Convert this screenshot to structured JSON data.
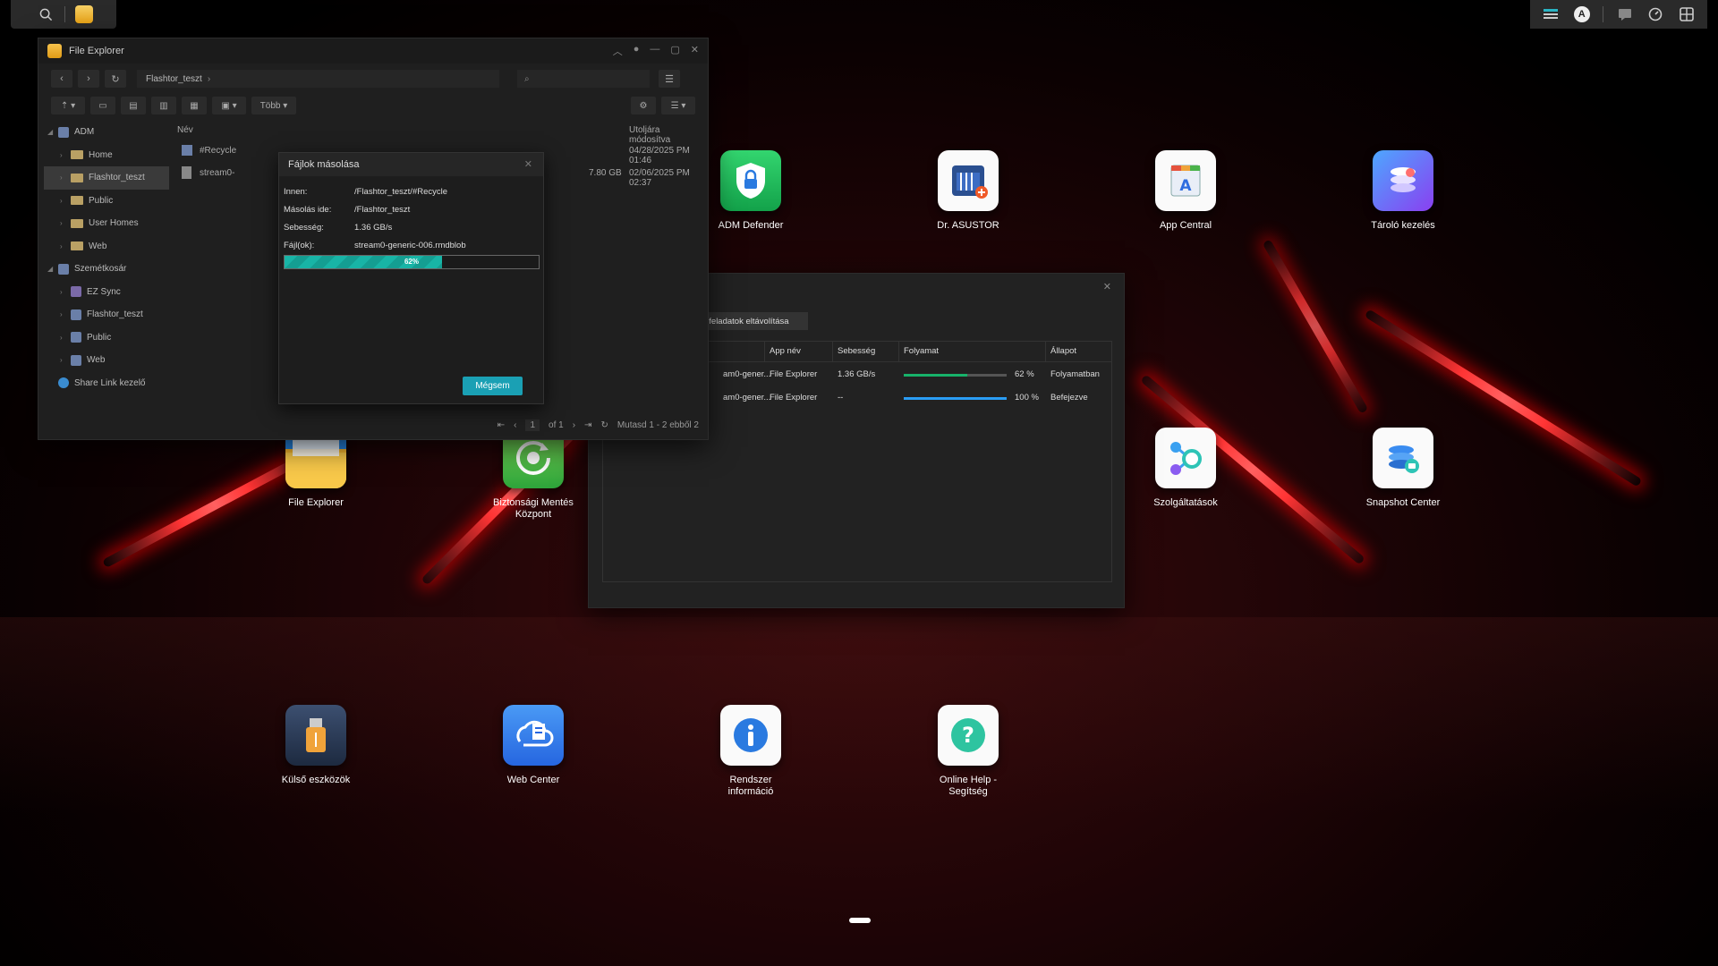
{
  "colors": {
    "accent": "#1aa0b4",
    "progress_green": "#17b26a",
    "progress_blue": "#2a9df4"
  },
  "taskbar": {
    "left_icons": [
      "search-icon",
      "file-explorer-icon"
    ],
    "right_icons": [
      "task-monitor-icon",
      "user-avatar-icon",
      "message-icon",
      "dashboard-icon",
      "app-grid-icon"
    ],
    "user_initial": "A"
  },
  "desktop_apps": [
    {
      "id": "adm-defender",
      "label": "ADM Defender",
      "icon": "shield-lock-icon",
      "color": "#20c15a"
    },
    {
      "id": "dr-asustor",
      "label": "Dr. ASUSTOR",
      "icon": "server-plus-icon",
      "color": "#ffffff"
    },
    {
      "id": "app-central",
      "label": "App Central",
      "icon": "store-icon",
      "color": "#ffffff"
    },
    {
      "id": "storage",
      "label": "Tároló kezelés",
      "icon": "disks-icon",
      "color": "#6a6cf0"
    },
    {
      "id": "file-explorer",
      "label": "File Explorer",
      "icon": "folder-icon",
      "color": "#f5b72a"
    },
    {
      "id": "backup",
      "label_lines": [
        "Biztonsági Mentés",
        "Központ"
      ],
      "icon": "backup-icon",
      "color": "#4fc13a"
    },
    {
      "id": "services",
      "label": "Szolgáltatások",
      "icon": "services-icon",
      "color": "#ffffff"
    },
    {
      "id": "snapshot",
      "label": "Snapshot Center",
      "icon": "snapshot-icon",
      "color": "#ffffff"
    },
    {
      "id": "external",
      "label": "Külső eszközök",
      "icon": "usb-icon",
      "color": "#2c3e5c"
    },
    {
      "id": "web-center",
      "label": "Web Center",
      "icon": "web-center-icon",
      "color": "#2f7bf0"
    },
    {
      "id": "sysinfo",
      "label_lines": [
        "Rendszer",
        "információ"
      ],
      "icon": "info-icon",
      "color": "#ffffff"
    },
    {
      "id": "help",
      "label_lines": [
        "Online Help -",
        "Segítség"
      ],
      "icon": "help-icon",
      "color": "#ffffff"
    }
  ],
  "file_explorer": {
    "title": "File Explorer",
    "path": "Flashtor_teszt",
    "search_placeholder": "",
    "more_label": "Több",
    "tree": [
      {
        "label": "ADM",
        "level": 0,
        "type": "vol"
      },
      {
        "label": "Home",
        "level": 1,
        "type": "folder"
      },
      {
        "label": "Flashtor_teszt",
        "level": 1,
        "type": "folder",
        "selected": true
      },
      {
        "label": "Public",
        "level": 1,
        "type": "folder"
      },
      {
        "label": "User Homes",
        "level": 1,
        "type": "folder"
      },
      {
        "label": "Web",
        "level": 1,
        "type": "folder"
      },
      {
        "label": "Szemétkosár",
        "level": 0,
        "type": "vol"
      },
      {
        "label": "EZ Sync",
        "level": 1,
        "type": "volp"
      },
      {
        "label": "Flashtor_teszt",
        "level": 1,
        "type": "vol"
      },
      {
        "label": "Public",
        "level": 1,
        "type": "vol"
      },
      {
        "label": "Web",
        "level": 1,
        "type": "vol"
      },
      {
        "label": "Share Link kezelő",
        "level": 0,
        "type": "link"
      }
    ],
    "columns": {
      "name": "Név",
      "modified": "Utoljára módosítva"
    },
    "files": [
      {
        "name": "#Recycle",
        "size": "",
        "modified": "04/28/2025 PM 01:46"
      },
      {
        "name": "stream0-",
        "size": "7.80 GB",
        "modified": "02/06/2025 PM 02:37"
      }
    ],
    "pager": {
      "page": "1",
      "of": "of 1",
      "summary": "Mutasd 1 - 2 ebből 2"
    }
  },
  "copy_dialog": {
    "title": "Fájlok másolása",
    "from_label": "Innen:",
    "from_value": "/Flashtor_teszt/#Recycle",
    "to_label": "Másolás ide:",
    "to_value": "/Flashtor_teszt",
    "speed_label": "Sebesség:",
    "speed_value": "1.36 GB/s",
    "files_label": "Fájl(ok):",
    "files_value": "stream0-generic-006.rmdblob",
    "progress_percent": 62,
    "progress_text": "62%",
    "cancel_label": "Mégsem"
  },
  "task_window": {
    "remove_label": "t feladatok eltávolítása",
    "columns": {
      "app": "App név",
      "speed": "Sebesség",
      "progress": "Folyamat",
      "status": "Állapot"
    },
    "rows": [
      {
        "name": "am0-gener...",
        "app": "File Explorer",
        "speed": "1.36 GB/s",
        "progress": 62,
        "progress_text": "62 %",
        "status": "Folyamatban"
      },
      {
        "name": "am0-gener...",
        "app": "File Explorer",
        "speed": "--",
        "progress": 100,
        "progress_text": "100 %",
        "status": "Befejezve"
      }
    ]
  }
}
